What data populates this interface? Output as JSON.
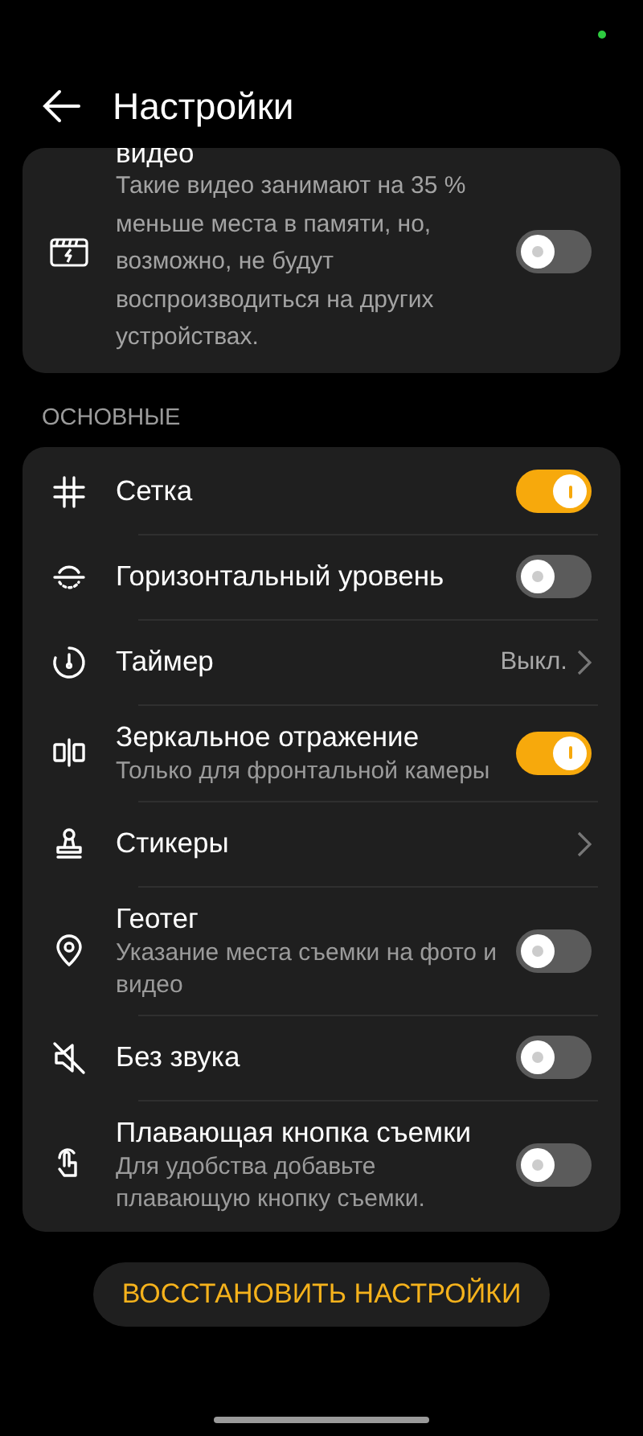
{
  "header": {
    "title": "Настройки"
  },
  "top_card": {
    "title": "видео",
    "subtitle": "Такие видео занимают на 35 % меньше места в памяти, но, возможно, не будут воспроизводиться на других устройствах.",
    "on": false
  },
  "section": {
    "title": "ОСНОВНЫЕ"
  },
  "items": [
    {
      "kind": "toggle",
      "title": "Сетка",
      "on": true
    },
    {
      "kind": "toggle",
      "title": "Горизонтальный уровень",
      "on": false
    },
    {
      "kind": "link",
      "title": "Таймер",
      "value": "Выкл."
    },
    {
      "kind": "toggle",
      "title": "Зеркальное отражение",
      "subtitle": "Только для фронтальной камеры",
      "on": true
    },
    {
      "kind": "link",
      "title": "Стикеры"
    },
    {
      "kind": "toggle",
      "title": "Геотег",
      "subtitle": "Указание места съемки на фото и видео",
      "on": false
    },
    {
      "kind": "toggle",
      "title": "Без звука",
      "on": false
    },
    {
      "kind": "toggle",
      "title": "Плавающая кнопка съемки",
      "subtitle": "Для удобства добавьте плавающую кнопку съемки.",
      "on": false
    }
  ],
  "reset_button": "ВОССТАНОВИТЬ НАСТРОЙКИ"
}
